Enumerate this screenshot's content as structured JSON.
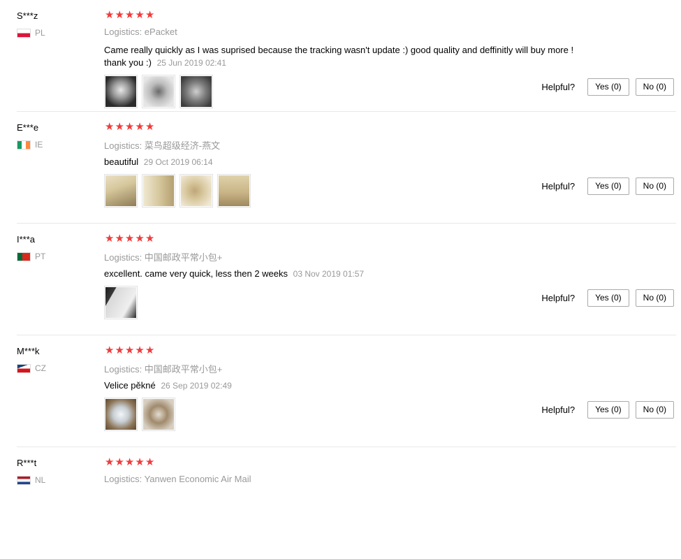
{
  "helpful_label": "Helpful?",
  "reviews": [
    {
      "user": "S***z",
      "country_code": "PL",
      "flag_colors": [
        "#ffffff",
        "#dc143c"
      ],
      "rating": 5,
      "logistics": "Logistics: ePacket",
      "text_line1": "Came really quickly as I was suprised because the tracking wasn't update :) good quality and deffinitly will buy more !",
      "text_line2": "thank you :)",
      "date": "25 Jun 2019 02:41",
      "photos": [
        "img-dark",
        "img-grey",
        "img-grey2"
      ],
      "yes": "Yes (0)",
      "no": "No (0)"
    },
    {
      "user": "E***e",
      "country_code": "IE",
      "flag_colors": [
        "#169b62",
        "#ffffff",
        "#ff883e"
      ],
      "rating": 5,
      "logistics": "Logistics: 菜鸟超级经济-燕文",
      "text_line1": "beautiful",
      "text_line2": "",
      "date": "29 Oct 2019 06:14",
      "photos": [
        "img-beige1",
        "img-beige2",
        "img-beige3",
        "img-beige4"
      ],
      "yes": "Yes (0)",
      "no": "No (0)"
    },
    {
      "user": "I***a",
      "country_code": "PT",
      "flag_colors": [
        "#046a38",
        "#da291c"
      ],
      "rating": 5,
      "logistics": "Logistics: 中国邮政平常小包+",
      "text_line1": "excellent. came very quick, less then 2 weeks",
      "text_line2": "",
      "date": "03 Nov 2019 01:57",
      "photos": [
        "img-card"
      ],
      "yes": "Yes (0)",
      "no": "No (0)"
    },
    {
      "user": "M***k",
      "country_code": "CZ",
      "flag_colors": [
        "#ffffff",
        "#d7141a",
        "#11457e"
      ],
      "rating": 5,
      "logistics": "Logistics: 中国邮政平常小包+",
      "text_line1": "Velice pěkné",
      "text_line2": "",
      "date": "26 Sep 2019 02:49",
      "photos": [
        "img-heart1",
        "img-heart2"
      ],
      "yes": "Yes (0)",
      "no": "No (0)"
    },
    {
      "user": "R***t",
      "country_code": "NL",
      "flag_colors": [
        "#ae1c28",
        "#ffffff",
        "#21468b"
      ],
      "rating": 5,
      "logistics": "Logistics: Yanwen Economic Air Mail",
      "text_line1": "",
      "text_line2": "",
      "date": "",
      "photos": [],
      "yes": "",
      "no": ""
    }
  ]
}
